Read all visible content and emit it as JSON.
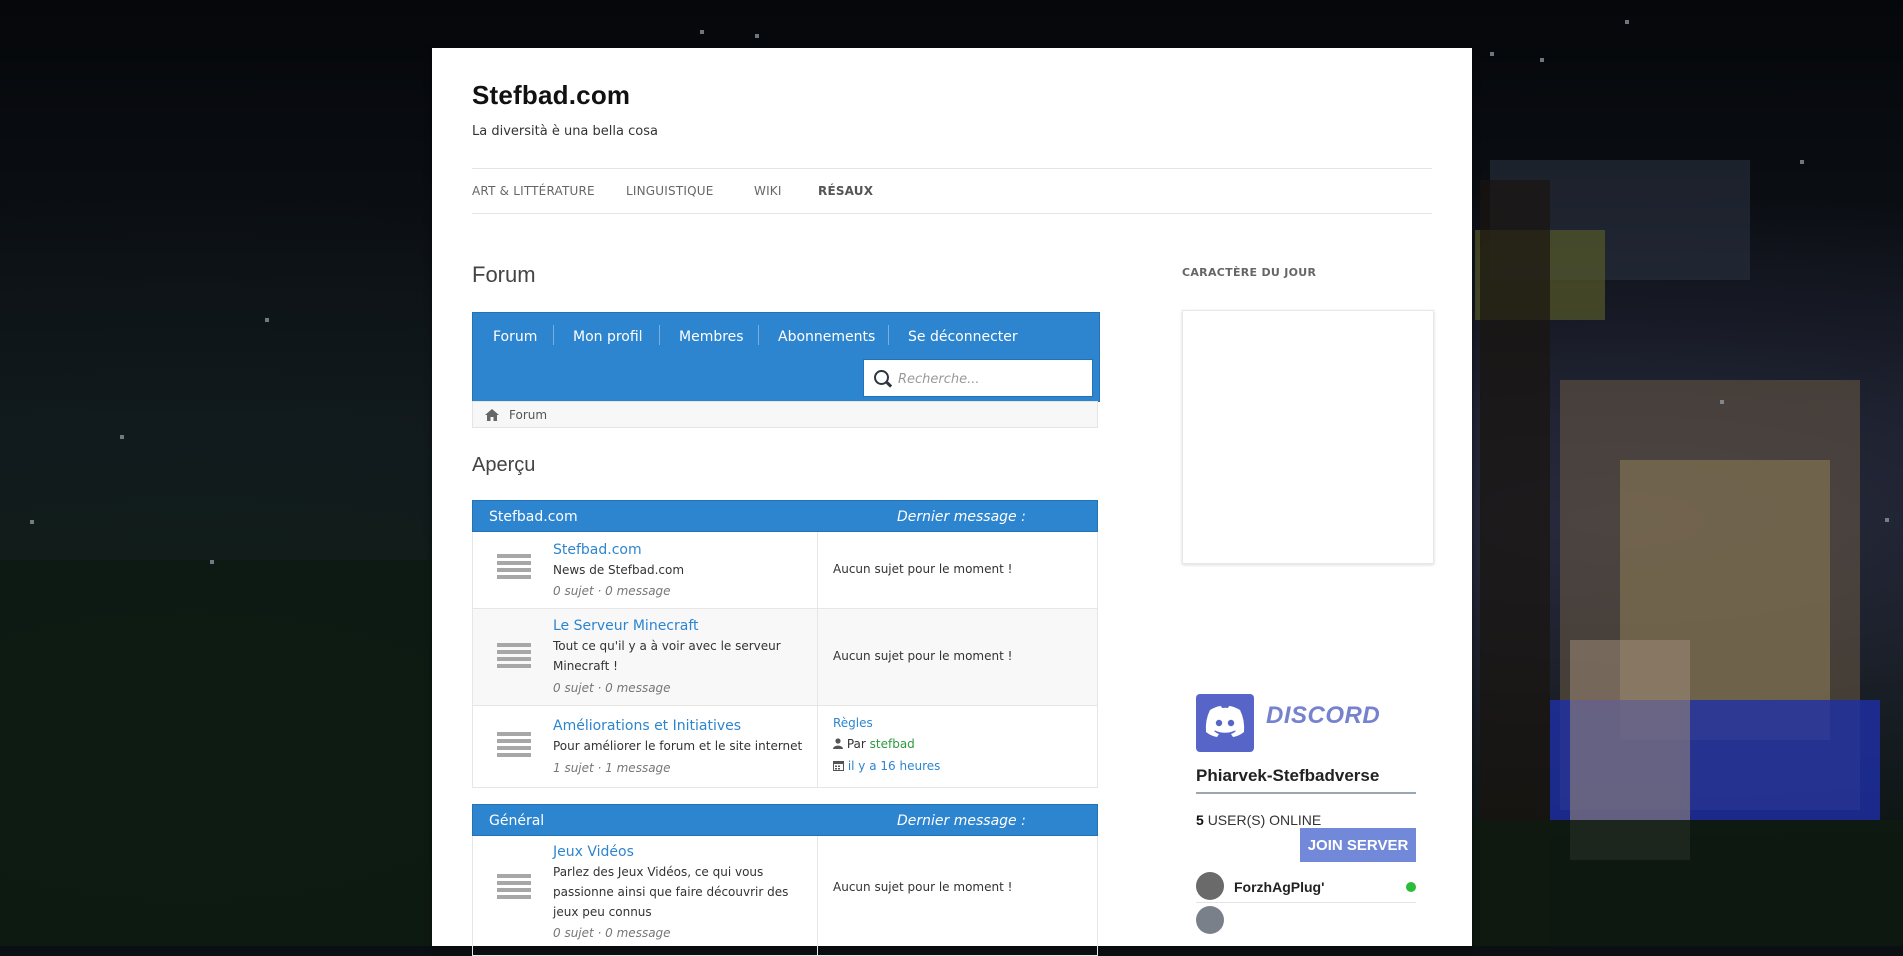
{
  "site": {
    "title": "Stefbad.com",
    "description": "La diversità è una bella cosa"
  },
  "nav": {
    "items": [
      "ART & LITTÉRATURE",
      "LINGUISTIQUE",
      "WIKI",
      "RÉSAUX"
    ]
  },
  "page": {
    "heading": "Forum",
    "overview_heading": "Aperçu"
  },
  "forum_menu": {
    "items": [
      "Forum",
      "Mon profil",
      "Membres",
      "Abonnements",
      "Se déconnecter"
    ]
  },
  "search": {
    "placeholder": "Recherche..."
  },
  "breadcrumb": {
    "label": "Forum"
  },
  "categories": [
    {
      "title": "Stefbad.com",
      "last_label": "Dernier message :",
      "forums": [
        {
          "title": "Stefbad.com",
          "description": "News de Stefbad.com",
          "stats": "0 sujet · 0 message",
          "last": "Aucun sujet pour le moment !"
        },
        {
          "title": "Le Serveur Minecraft",
          "description": "Tout ce qu'il y a à voir avec le serveur Minecraft !",
          "stats": "0 sujet · 0 message",
          "last": "Aucun sujet pour le moment !"
        },
        {
          "title": "Améliorations et Initiatives",
          "description": "Pour améliorer le forum et le site internet",
          "stats": "1 sujet · 1 message",
          "last_topic": "Règles",
          "last_by_prefix": "Par",
          "last_by": "stefbad",
          "last_date": "il y a 16 heures"
        }
      ]
    },
    {
      "title": "Général",
      "last_label": "Dernier message :",
      "forums": [
        {
          "title": "Jeux Vidéos",
          "description": "Parlez des Jeux Vidéos, ce qui vous passionne ainsi que faire découvrir des jeux peu connus",
          "stats": "0 sujet · 0 message",
          "last": "Aucun sujet pour le moment !"
        }
      ]
    }
  ],
  "sidebar": {
    "widget_title": "CARACTÈRE DU JOUR",
    "discord": {
      "logo_text": "DISCORD",
      "server_name": "Phiarvek-Stefbadverse",
      "online_count": "5",
      "online_label": "USER(S) ONLINE",
      "join_label": "JOIN SERVER",
      "users": [
        {
          "name": "ForzhAgPlug'"
        }
      ]
    }
  },
  "colors": {
    "accent": "#2d85cf",
    "discord": "#7289da",
    "online": "#2bbc3a"
  }
}
